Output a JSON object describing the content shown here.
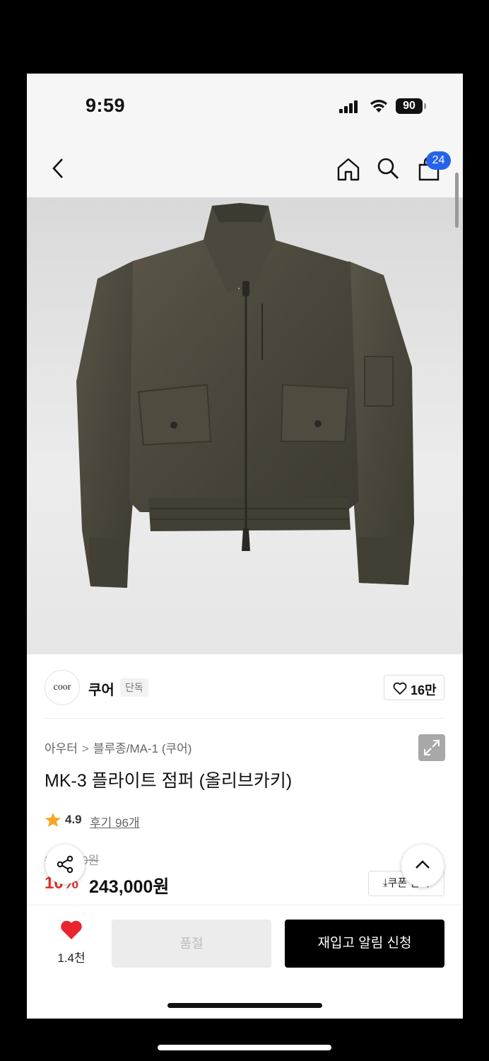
{
  "status_bar": {
    "time": "9:59",
    "battery": "90"
  },
  "nav": {
    "cart_count": "24"
  },
  "brand": {
    "logo_text": "coor",
    "name": "쿠어",
    "badge": "단독",
    "like_count": "16만"
  },
  "breadcrumb": {
    "category": "아우터",
    "subcategory": "블루종/MA-1 (쿠어)"
  },
  "product": {
    "title": "MK-3 플라이트 점퍼 (올리브카키)",
    "rating": "4.9",
    "reviews": "후기 96개",
    "original_price": "270,000원",
    "discount": "10%",
    "price": "243,000원",
    "coupon_label": "쿠폰 받기"
  },
  "bottom_bar": {
    "wish_count": "1.4천",
    "soldout_label": "품절",
    "notify_label": "재입고 알림 신청"
  },
  "colors": {
    "accent_blue": "#2563eb",
    "sale_red": "#e0322b",
    "heart_red": "#e8242f",
    "star": "#f5a623"
  }
}
